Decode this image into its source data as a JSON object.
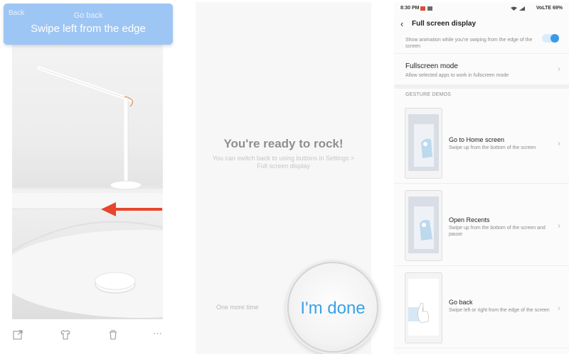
{
  "panel1": {
    "banner": {
      "back_label": "Back",
      "title": "Go back",
      "instruction": "Swipe left from the edge"
    },
    "arrow_color": "#e8452c",
    "toolbar_icons": [
      "share-icon",
      "shirt-icon",
      "trash-icon",
      "more-icon"
    ],
    "more_glyph": "···"
  },
  "panel2": {
    "title": "You're ready to rock!",
    "description": "You can switch back to using buttons in Settings > Full screen display",
    "one_more_time": "One more time",
    "done_button": "I'm done",
    "accent_color": "#3aa2e6"
  },
  "panel3": {
    "status_bar": {
      "time": "8:30 PM",
      "right_text": "VoLTE 69%"
    },
    "header": {
      "back_glyph": "‹",
      "title": "Full screen display"
    },
    "partial_row": {
      "subtitle": "Show animation while you're swiping from the edge of the screen",
      "toggle_on": true
    },
    "fullscreen_row": {
      "title": "Fullscreen mode",
      "subtitle": "Allow selected apps to work in fullscreen mode"
    },
    "section_header": "GESTURE DEMOS",
    "demos": [
      {
        "title": "Go to Home screen",
        "subtitle": "Swipe up from the bottom of the screen"
      },
      {
        "title": "Open Recents",
        "subtitle": "Swipe up from the bottom of the screen and pause"
      },
      {
        "title": "Go back",
        "subtitle": "Swipe left or right from the edge of the screen"
      }
    ],
    "chevron": "›"
  }
}
